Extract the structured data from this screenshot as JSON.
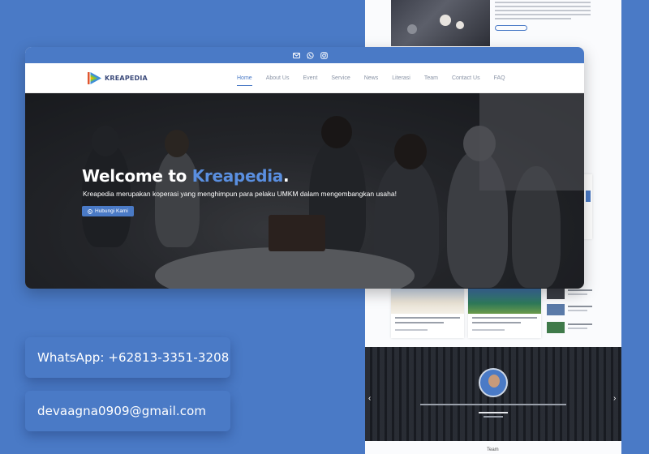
{
  "brand": {
    "name": "KREAPEDIA",
    "accent": "#4a7ac6"
  },
  "topbar": {
    "icons": [
      "mail-icon",
      "whatsapp-icon",
      "instagram-icon"
    ]
  },
  "nav": {
    "items": [
      {
        "label": "Home",
        "active": true
      },
      {
        "label": "About Us"
      },
      {
        "label": "Event"
      },
      {
        "label": "Service"
      },
      {
        "label": "News"
      },
      {
        "label": "Literasi"
      },
      {
        "label": "Team"
      },
      {
        "label": "Contact Us"
      },
      {
        "label": "FAQ"
      }
    ]
  },
  "hero": {
    "title_prefix": "Welcome to ",
    "title_brand": "Kreapedia",
    "title_suffix": ".",
    "subtitle": "Kreapedia merupakan koperasi yang menghimpun para pelaku UMKM dalam mengembangkan usaha!",
    "button_label": "Hubungi Kami"
  },
  "contact": {
    "whatsapp": "WhatsApp: +62813-3351-3208",
    "email": "devaagna0909@gmail.com"
  },
  "background_page": {
    "team_title": "Team"
  }
}
